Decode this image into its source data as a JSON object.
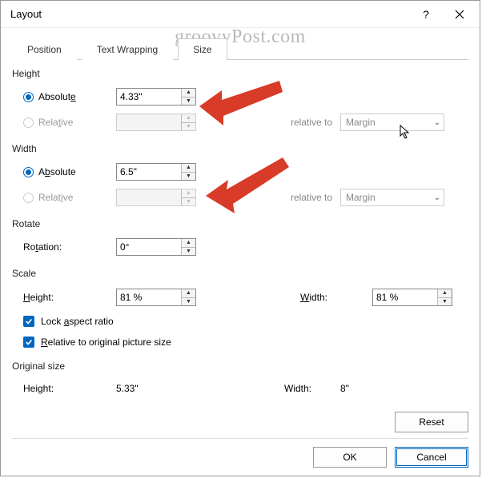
{
  "window": {
    "title": "Layout"
  },
  "watermark": "groovyPost.com",
  "tabs": {
    "position": "Position",
    "text_wrapping": "Text Wrapping",
    "size": "Size"
  },
  "height": {
    "section": "Height",
    "absolute_label": "Absolute",
    "absolute_value": "4.33\"",
    "relative_label": "Relative",
    "relative_value": "",
    "relative_to_label": "relative to",
    "relative_to_value": "Margin"
  },
  "width": {
    "section": "Width",
    "absolute_label": "Absolute",
    "absolute_value": "6.5\"",
    "relative_label": "Relative",
    "relative_value": "",
    "relative_to_label": "relative to",
    "relative_to_value": "Margin"
  },
  "rotate": {
    "section": "Rotate",
    "rotation_label": "Rotation:",
    "rotation_value": "0°"
  },
  "scale": {
    "section": "Scale",
    "height_label": "Height:",
    "height_value": "81 %",
    "width_label": "Width:",
    "width_value": "81 %",
    "lock_aspect": "Lock aspect ratio",
    "relative_original": "Relative to original picture size"
  },
  "original": {
    "section": "Original size",
    "height_label": "Height:",
    "height_value": "5.33\"",
    "width_label": "Width:",
    "width_value": "8\""
  },
  "buttons": {
    "reset": "Reset",
    "ok": "OK",
    "cancel": "Cancel"
  }
}
